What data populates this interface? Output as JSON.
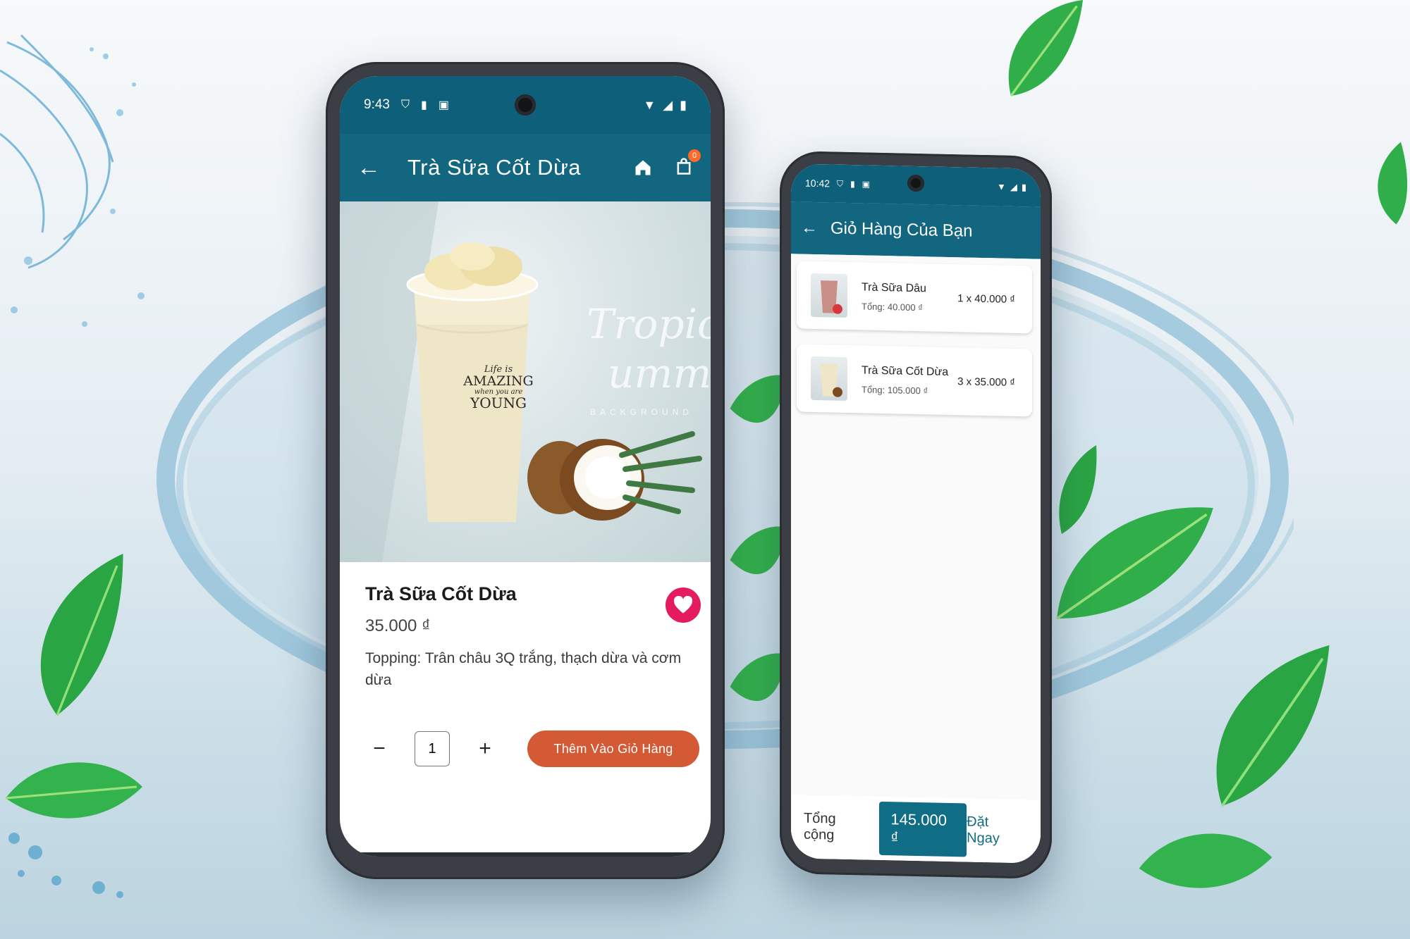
{
  "phone_product": {
    "status": {
      "time": "9:43"
    },
    "appbar": {
      "title": "Trà Sữa Cốt Dừa",
      "cart_badge": "0"
    },
    "hero": {
      "script_line1": "Tropica",
      "script_line2": "umm",
      "small_caption": "BACKGROUND",
      "cup_print": [
        "Life is",
        "AMAZING",
        "when you are",
        "YOUNG"
      ]
    },
    "product": {
      "name": "Trà Sữa Cốt Dừa",
      "price": "35.000 ₫",
      "description": "Topping: Trân châu 3Q trắng, thạch dừa và cơm dừa",
      "quantity": "1",
      "minus_label": "−",
      "plus_label": "+",
      "add_to_cart_label": "Thêm Vào Giỏ Hàng"
    }
  },
  "phone_cart": {
    "status": {
      "time": "10:42"
    },
    "appbar": {
      "title": "Giỏ Hàng Của Bạn"
    },
    "items": [
      {
        "name": "Trà Sữa Dâu",
        "total": "Tổng: 40.000 ₫",
        "qty_price": "1 x 40.000 ₫"
      },
      {
        "name": "Trà Sữa Cốt Dừa",
        "total": "Tổng: 105.000 ₫",
        "qty_price": "3 x 35.000 ₫"
      }
    ],
    "footer": {
      "total_label": "Tổng cộng",
      "total_value": "145.000 ₫",
      "order_label": "Đặt Ngay"
    }
  },
  "colors": {
    "primary": "#12667f",
    "statusbar": "#0e5f7a",
    "accent_button": "#d35a34",
    "favorite": "#e41b5f",
    "badge": "#ff6a2b"
  }
}
